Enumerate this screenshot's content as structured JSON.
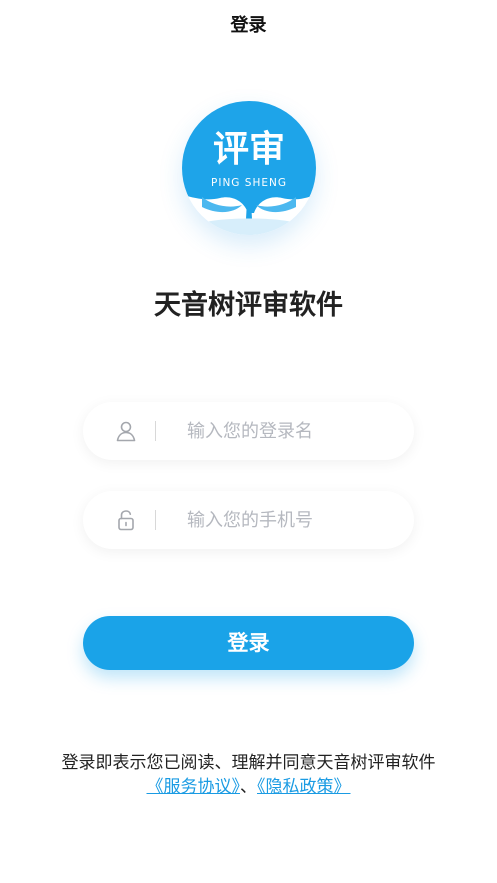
{
  "header": {
    "title": "登录"
  },
  "logo": {
    "main_text": "评审",
    "sub_text": "PING SHENG",
    "icon": "tree-logo-icon"
  },
  "app": {
    "name": "天音树评审软件"
  },
  "form": {
    "username": {
      "placeholder": "输入您的登录名",
      "value": "",
      "icon": "user-icon"
    },
    "phone": {
      "placeholder": "输入您的手机号",
      "value": "",
      "icon": "unlock-icon"
    },
    "login_label": "登录"
  },
  "agreement": {
    "text": "登录即表示您已阅读、理解并同意天音树评审软件",
    "service_link": "《服务协议》",
    "separator": "、",
    "privacy_link": "《隐私政策》"
  },
  "colors": {
    "accent": "#1aa3e8",
    "link": "#1a9be3",
    "placeholder": "#b5b8bf"
  }
}
